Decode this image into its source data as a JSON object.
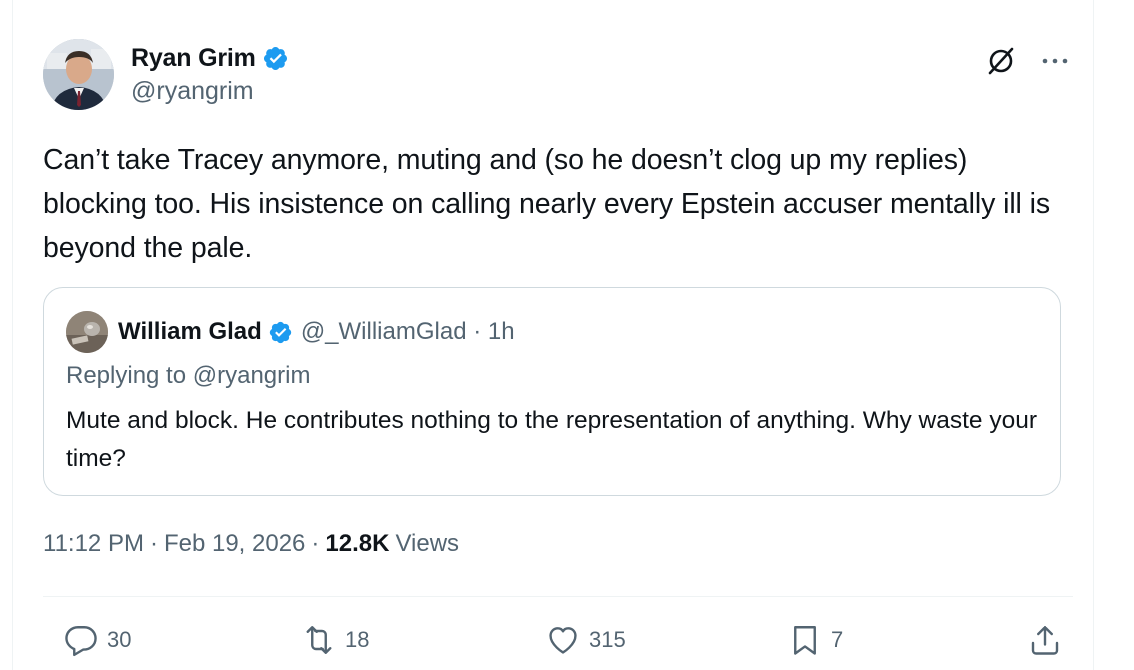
{
  "author": {
    "display_name": "Ryan Grim",
    "handle": "@ryangrim"
  },
  "tweet": {
    "text": "Can’t take Tracey anymore, muting and (so he doesn’t clog up my replies) blocking too. His insistence on calling nearly every Epstein accuser mentally ill is beyond the pale."
  },
  "quote": {
    "display_name": "William Glad",
    "meta": "@_WilliamGlad · 1h",
    "replying_label": "Replying to",
    "replying_handle": "@ryangrim",
    "text": "Mute and block. He contributes nothing to the representation of anything. Why waste your time?"
  },
  "meta": {
    "time": "11:12 PM",
    "sep1": "·",
    "date": "Feb 19, 2026",
    "sep2": "·",
    "views_count": "12.8K",
    "views_label": "Views"
  },
  "actions": {
    "replies": "30",
    "reposts": "18",
    "likes": "315",
    "bookmarks": "7"
  },
  "colors": {
    "verified": "#1d9bf0",
    "secondary_text": "#536471",
    "primary_text": "#0f1419",
    "border": "#cfd9de"
  },
  "icons": [
    "verified-badge-icon",
    "grok-icon",
    "more-icon",
    "reply-icon",
    "repost-icon",
    "like-icon",
    "bookmark-icon",
    "share-icon"
  ]
}
